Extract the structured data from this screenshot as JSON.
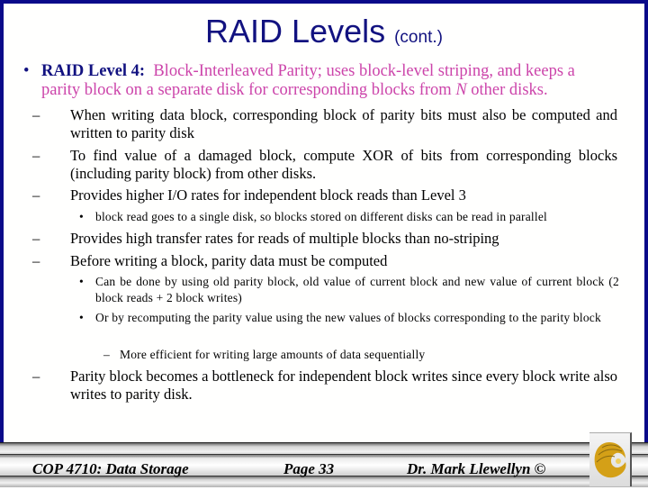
{
  "slide": {
    "title": "RAID Levels",
    "title_suffix": "(cont.)",
    "main_bullet": {
      "marker": "•",
      "heading": "RAID Level 4:",
      "text_line1": "Block-Interleaved Parity; uses block-level striping, and keeps a",
      "text_line2_pre": "parity block on a separate disk for corresponding blocks from ",
      "text_line2_var": "N",
      "text_line2_post": " other disks."
    },
    "sub_bullets": [
      {
        "marker": "–",
        "text": "When writing data block, corresponding block of parity bits must also be computed and written to parity disk"
      },
      {
        "marker": "–",
        "text": "To find value of a damaged block, compute XOR of bits from corresponding blocks (including parity block) from other disks."
      },
      {
        "marker": "–",
        "text": "Provides higher I/O rates for independent block reads than Level 3"
      },
      {
        "marker": "•",
        "text": "block read goes to a single disk, so blocks stored on different disks can be read in parallel"
      },
      {
        "marker": "–",
        "text": "Provides high transfer rates for reads of multiple blocks than no-striping"
      },
      {
        "marker": "–",
        "text": "Before writing a block, parity data must be computed"
      },
      {
        "marker": "•",
        "text": "Can be done by using old parity block, old value of current block and new value of current block (2 block reads + 2 block writes)"
      },
      {
        "marker": "•",
        "text": "Or by recomputing the parity value using the new values of blocks corresponding to the parity block"
      },
      {
        "marker": "–",
        "text": "More efficient for writing large amounts of data sequentially"
      },
      {
        "marker": "–",
        "text": "Parity block becomes a bottleneck for independent block writes since every block write also writes to parity disk."
      }
    ]
  },
  "footer": {
    "course": "COP 4710: Data Storage",
    "page": "Page 33",
    "author": "Dr. Mark Llewellyn ©",
    "logo": "pegasus-logo-icon"
  },
  "colors": {
    "frame": "#0a0a8a",
    "title": "#121280",
    "accent_pink": "#cc44aa",
    "logo_gold": "#d4a017"
  }
}
